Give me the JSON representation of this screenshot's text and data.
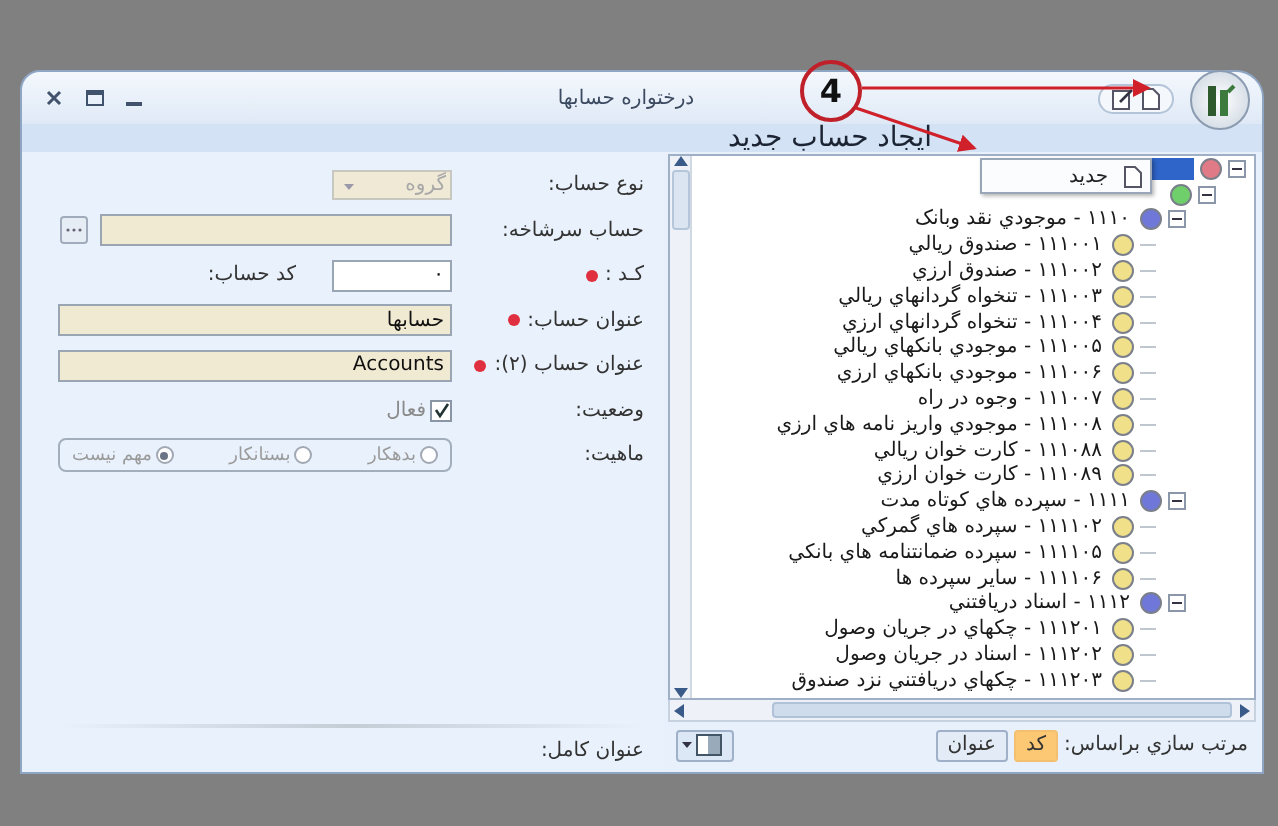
{
  "window": {
    "title": "درختواره حسابها",
    "header": "ایجاد حساب جدید"
  },
  "annotation": {
    "label": "4"
  },
  "form": {
    "account_type": {
      "label": "نوع حساب:",
      "value": "گروه",
      "disabled": true
    },
    "parent_account": {
      "label": "حساب سرشاخه:"
    },
    "code": {
      "label": "کـد :",
      "required": true,
      "value": "۰",
      "side_label": "کد حساب:"
    },
    "title": {
      "label": "عنوان حساب:",
      "required": true,
      "value": "حسابها"
    },
    "title2": {
      "label": "عنوان حساب (۲):",
      "required": true,
      "value": "Accounts"
    },
    "status": {
      "label": "وضعیت:",
      "option": "فعال",
      "checked": true
    },
    "nature": {
      "label": "ماهیت:",
      "options": [
        {
          "label": "بدهکار",
          "selected": false
        },
        {
          "label": "بستانکار",
          "selected": false
        },
        {
          "label": "مهم نیست",
          "selected": true
        }
      ]
    },
    "full_title": {
      "label": "عنوان کامل:"
    }
  },
  "context_menu": {
    "items": [
      {
        "label": "جدید"
      }
    ]
  },
  "tree": {
    "nodes": [
      {
        "color": "#e07a86",
        "expanded": true,
        "selected": true,
        "children": [
          {
            "color": "#6fcf6a",
            "expanded": true,
            "selected": false,
            "children": [
              {
                "label": "۱۱۱۰ - موجودي نقد وبانک",
                "color": "#6f78d8",
                "expanded": true,
                "selected": false,
                "children": [
                  {
                    "label": "۱۱۱۰۰۱ - صندوق ريالي",
                    "color": "#f0e08a",
                    "selected": false
                  },
                  {
                    "label": "۱۱۱۰۰۲ - صندوق ارزي",
                    "color": "#f0e08a",
                    "selected": false
                  },
                  {
                    "label": "۱۱۱۰۰۳ - تنخواه گردانهاي ريالي",
                    "color": "#f0e08a",
                    "selected": false
                  },
                  {
                    "label": "۱۱۱۰۰۴ - تنخواه گردانهاي ارزي",
                    "color": "#f0e08a",
                    "selected": false
                  },
                  {
                    "label": "۱۱۱۰۰۵ - موجودي بانکهاي ريالي",
                    "color": "#f0e08a",
                    "selected": false
                  },
                  {
                    "label": "۱۱۱۰۰۶ - موجودي بانکهاي ارزي",
                    "color": "#f0e08a",
                    "selected": false
                  },
                  {
                    "label": "۱۱۱۰۰۷ - وجوه در راه",
                    "color": "#f0e08a",
                    "selected": false
                  },
                  {
                    "label": "۱۱۱۰۰۸ - موجودي واريز نامه هاي ارزي",
                    "color": "#f0e08a",
                    "selected": false
                  },
                  {
                    "label": "۱۱۱۰۸۸ - کارت خوان ريالي",
                    "color": "#f0e08a",
                    "selected": false
                  },
                  {
                    "label": "۱۱۱۰۸۹ - کارت خوان ارزي",
                    "color": "#f0e08a",
                    "selected": false
                  }
                ]
              },
              {
                "label": "۱۱۱۱ - سپرده هاي کوتاه مدت",
                "color": "#6f78d8",
                "expanded": true,
                "selected": false,
                "children": [
                  {
                    "label": "۱۱۱۱۰۲ - سپرده هاي گمرکي",
                    "color": "#f0e08a",
                    "selected": false
                  },
                  {
                    "label": "۱۱۱۱۰۵ - سپرده ضمانتنامه هاي بانکي",
                    "color": "#f0e08a",
                    "selected": false
                  },
                  {
                    "label": "۱۱۱۱۰۶ - ساير سپرده ها",
                    "color": "#f0e08a",
                    "selected": false
                  }
                ]
              },
              {
                "label": "۱۱۱۲ - اسناد دريافتني",
                "color": "#6f78d8",
                "expanded": true,
                "selected": false,
                "children": [
                  {
                    "label": "۱۱۱۲۰۱ - چکهاي در جريان وصول",
                    "color": "#f0e08a",
                    "selected": false
                  },
                  {
                    "label": "۱۱۱۲۰۲ - اسناد در جريان وصول",
                    "color": "#f0e08a",
                    "selected": false
                  },
                  {
                    "label": "۱۱۱۲۰۳ - چکهاي دريافتني نزد صندوق",
                    "color": "#f0e08a",
                    "selected": false
                  }
                ]
              }
            ]
          }
        ]
      }
    ]
  },
  "sort_bar": {
    "label": "مرتب سازي براساس:",
    "options": [
      {
        "label": "کد",
        "selected": true
      },
      {
        "label": "عنوان",
        "selected": false
      }
    ]
  }
}
